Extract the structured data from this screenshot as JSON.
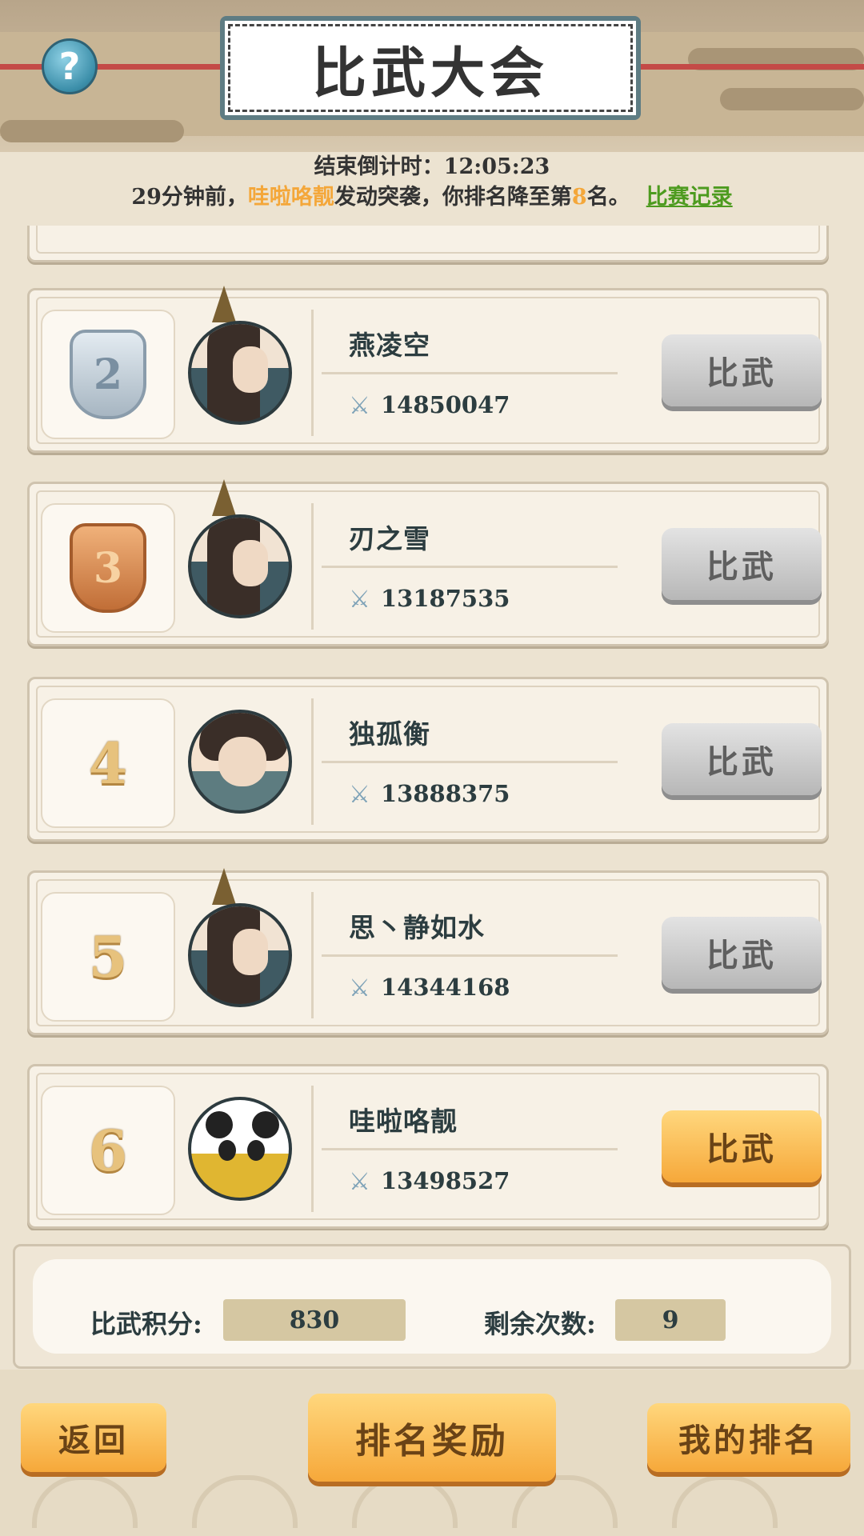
{
  "header": {
    "title": "比武大会",
    "help_symbol": "?",
    "countdown": "结束倒计时：12:05:23",
    "notice": {
      "prefix": "29分钟前，",
      "attacker": "哇啦咯靓",
      "middle": "发动突袭，你排名降至第",
      "rank": "8",
      "suffix": "名。",
      "link": "比赛记录"
    }
  },
  "players": [
    {
      "rank": "2",
      "badge": "silver",
      "avatar": "male",
      "name": "燕凌空",
      "power": "14850047",
      "button": "比武",
      "button_style": "grey"
    },
    {
      "rank": "3",
      "badge": "bronze",
      "avatar": "male",
      "name": "刃之雪",
      "power": "13187535",
      "button": "比武",
      "button_style": "grey"
    },
    {
      "rank": "4",
      "badge": "",
      "avatar": "female",
      "name": "独孤衡",
      "power": "13888375",
      "button": "比武",
      "button_style": "grey"
    },
    {
      "rank": "5",
      "badge": "",
      "avatar": "male",
      "name": "思丶静如水",
      "power": "14344168",
      "button": "比武",
      "button_style": "grey"
    },
    {
      "rank": "6",
      "badge": "",
      "avatar": "panda",
      "name": "哇啦咯靓",
      "power": "13498527",
      "button": "比武",
      "button_style": "gold"
    }
  ],
  "stats": {
    "score_label": "比武积分:",
    "score_value": "830",
    "remaining_label": "剩余次数:",
    "remaining_value": "9"
  },
  "footer": {
    "back": "返回",
    "rewards": "排名奖励",
    "my_rank": "我的排名"
  },
  "icons": {
    "help": "question-icon",
    "power": "crossed-swords-icon"
  },
  "colors": {
    "accent_orange": "#f4a73a",
    "link_green": "#4d9b1f",
    "gold_button": "#f6a83a",
    "grey_button": "#b7b7b7"
  }
}
